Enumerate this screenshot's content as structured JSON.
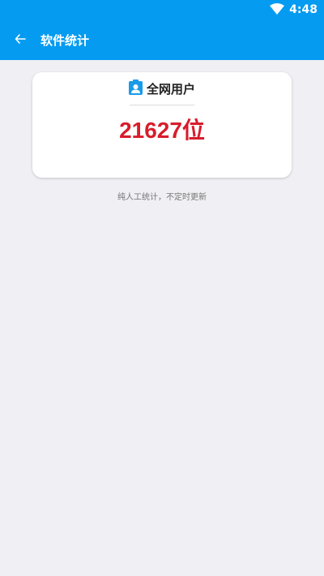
{
  "status_bar": {
    "time": "4:48",
    "icons": [
      "wifi-icon"
    ],
    "background": "#049bf1"
  },
  "app_bar": {
    "title": "软件统计",
    "back_icon": "back-arrow-icon",
    "background": "#049bf1"
  },
  "stats_card": {
    "icon": "user-badge-icon",
    "title": "全网用户",
    "count": "21627位",
    "count_color": "#d81d2b",
    "icon_color": "#1a9be8"
  },
  "footer_note": "纯人工统计，不定时更新"
}
